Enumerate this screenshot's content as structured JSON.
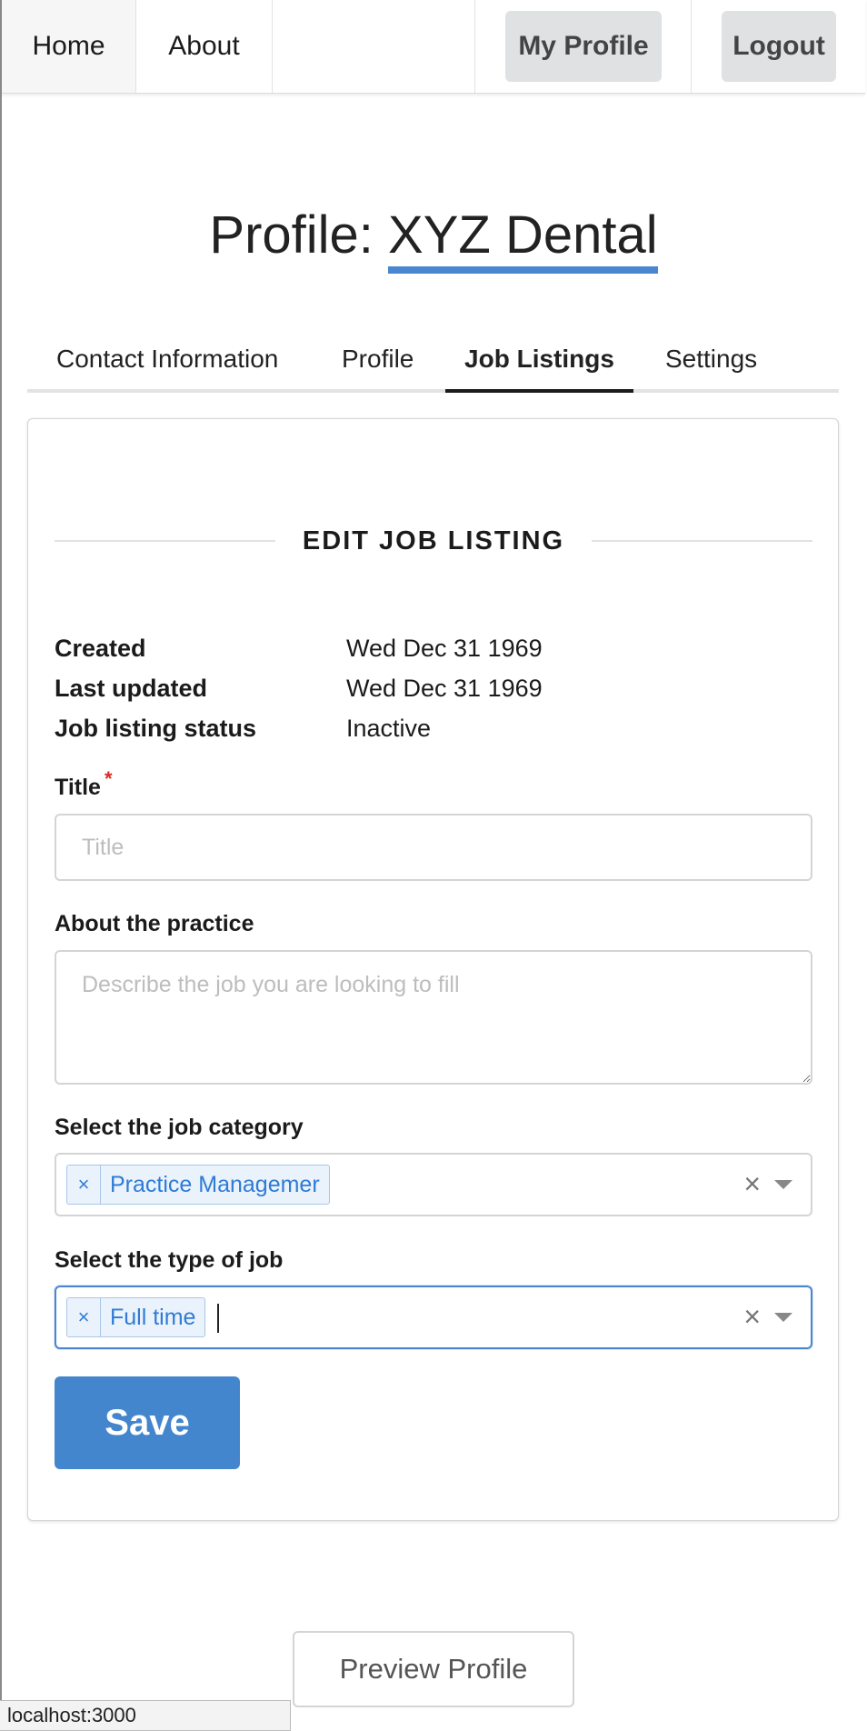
{
  "nav": {
    "home": "Home",
    "about": "About",
    "my_profile": "My Profile",
    "logout": "Logout"
  },
  "header": {
    "title_prefix": "Profile:",
    "title_name": "XYZ Dental"
  },
  "tabs": [
    {
      "label": "Contact Information"
    },
    {
      "label": "Profile"
    },
    {
      "label": "Job Listings",
      "active": true
    },
    {
      "label": "Settings"
    }
  ],
  "form": {
    "section_title": "EDIT JOB LISTING",
    "meta": [
      {
        "label": "Created",
        "value": "Wed Dec 31 1969"
      },
      {
        "label": "Last updated",
        "value": "Wed Dec 31 1969"
      },
      {
        "label": "Job listing status",
        "value": "Inactive"
      }
    ],
    "title_label": "Title",
    "required_mark": "*",
    "title_placeholder": "Title",
    "about_label": "About the practice",
    "about_placeholder": "Describe the job you are looking to fill",
    "category_label": "Select the job category",
    "category_selected": "Practice Managemer",
    "type_label": "Select the type of job",
    "type_selected": "Full time",
    "chip_remove": "×",
    "clear_symbol": "×",
    "save_label": "Save"
  },
  "preview_label": "Preview Profile",
  "status_bar": "localhost:3000",
  "colors": {
    "accent": "#4386cd",
    "underline": "#4a86cf",
    "required": "#db2828",
    "chip_text": "#2f7bd6"
  }
}
